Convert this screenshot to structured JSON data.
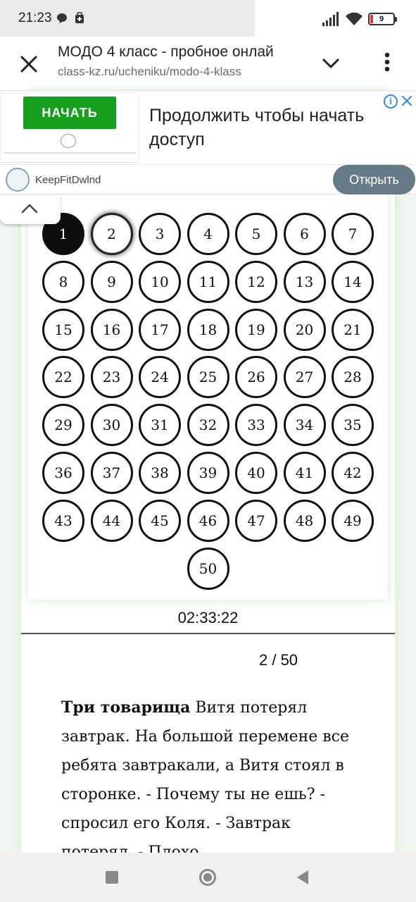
{
  "status_bar": {
    "time": "21:23",
    "battery": "9"
  },
  "browser": {
    "title": "МОДО 4 класс - пробное онлай",
    "url": "class-kz.ru/ucheniku/modo-4-klass"
  },
  "ad": {
    "start_label": "НАЧАТЬ",
    "headline": "Продолжить чтобы начать доступ",
    "brand": "KeepFitDwlnd",
    "open_label": "Открыть"
  },
  "question_nav": {
    "numbers": [
      "1",
      "2",
      "3",
      "4",
      "5",
      "6",
      "7",
      "8",
      "9",
      "10",
      "11",
      "12",
      "13",
      "14",
      "15",
      "16",
      "17",
      "18",
      "19",
      "20",
      "21",
      "22",
      "23",
      "24",
      "25",
      "26",
      "27",
      "28",
      "29",
      "30",
      "31",
      "32",
      "33",
      "34",
      "35",
      "36",
      "37",
      "38",
      "39",
      "40",
      "41",
      "42",
      "43",
      "44",
      "45",
      "46",
      "47",
      "48",
      "49",
      "50"
    ],
    "answered": [
      1
    ],
    "current": 2
  },
  "timer": "02:33:22",
  "counter": "2 / 50",
  "question": {
    "title": "Три товарища",
    "text": " Витя потерял завтрак. На большой перемене все ребята завтракали, а Витя стоял в сторонке. - Почему ты не ешь? - спросил его Коля. - Завтрак потерял. - Плохо"
  },
  "colors": {
    "ad_button": "#16a01e",
    "open_button": "#667a87",
    "card_glow": "#c9eec9"
  }
}
